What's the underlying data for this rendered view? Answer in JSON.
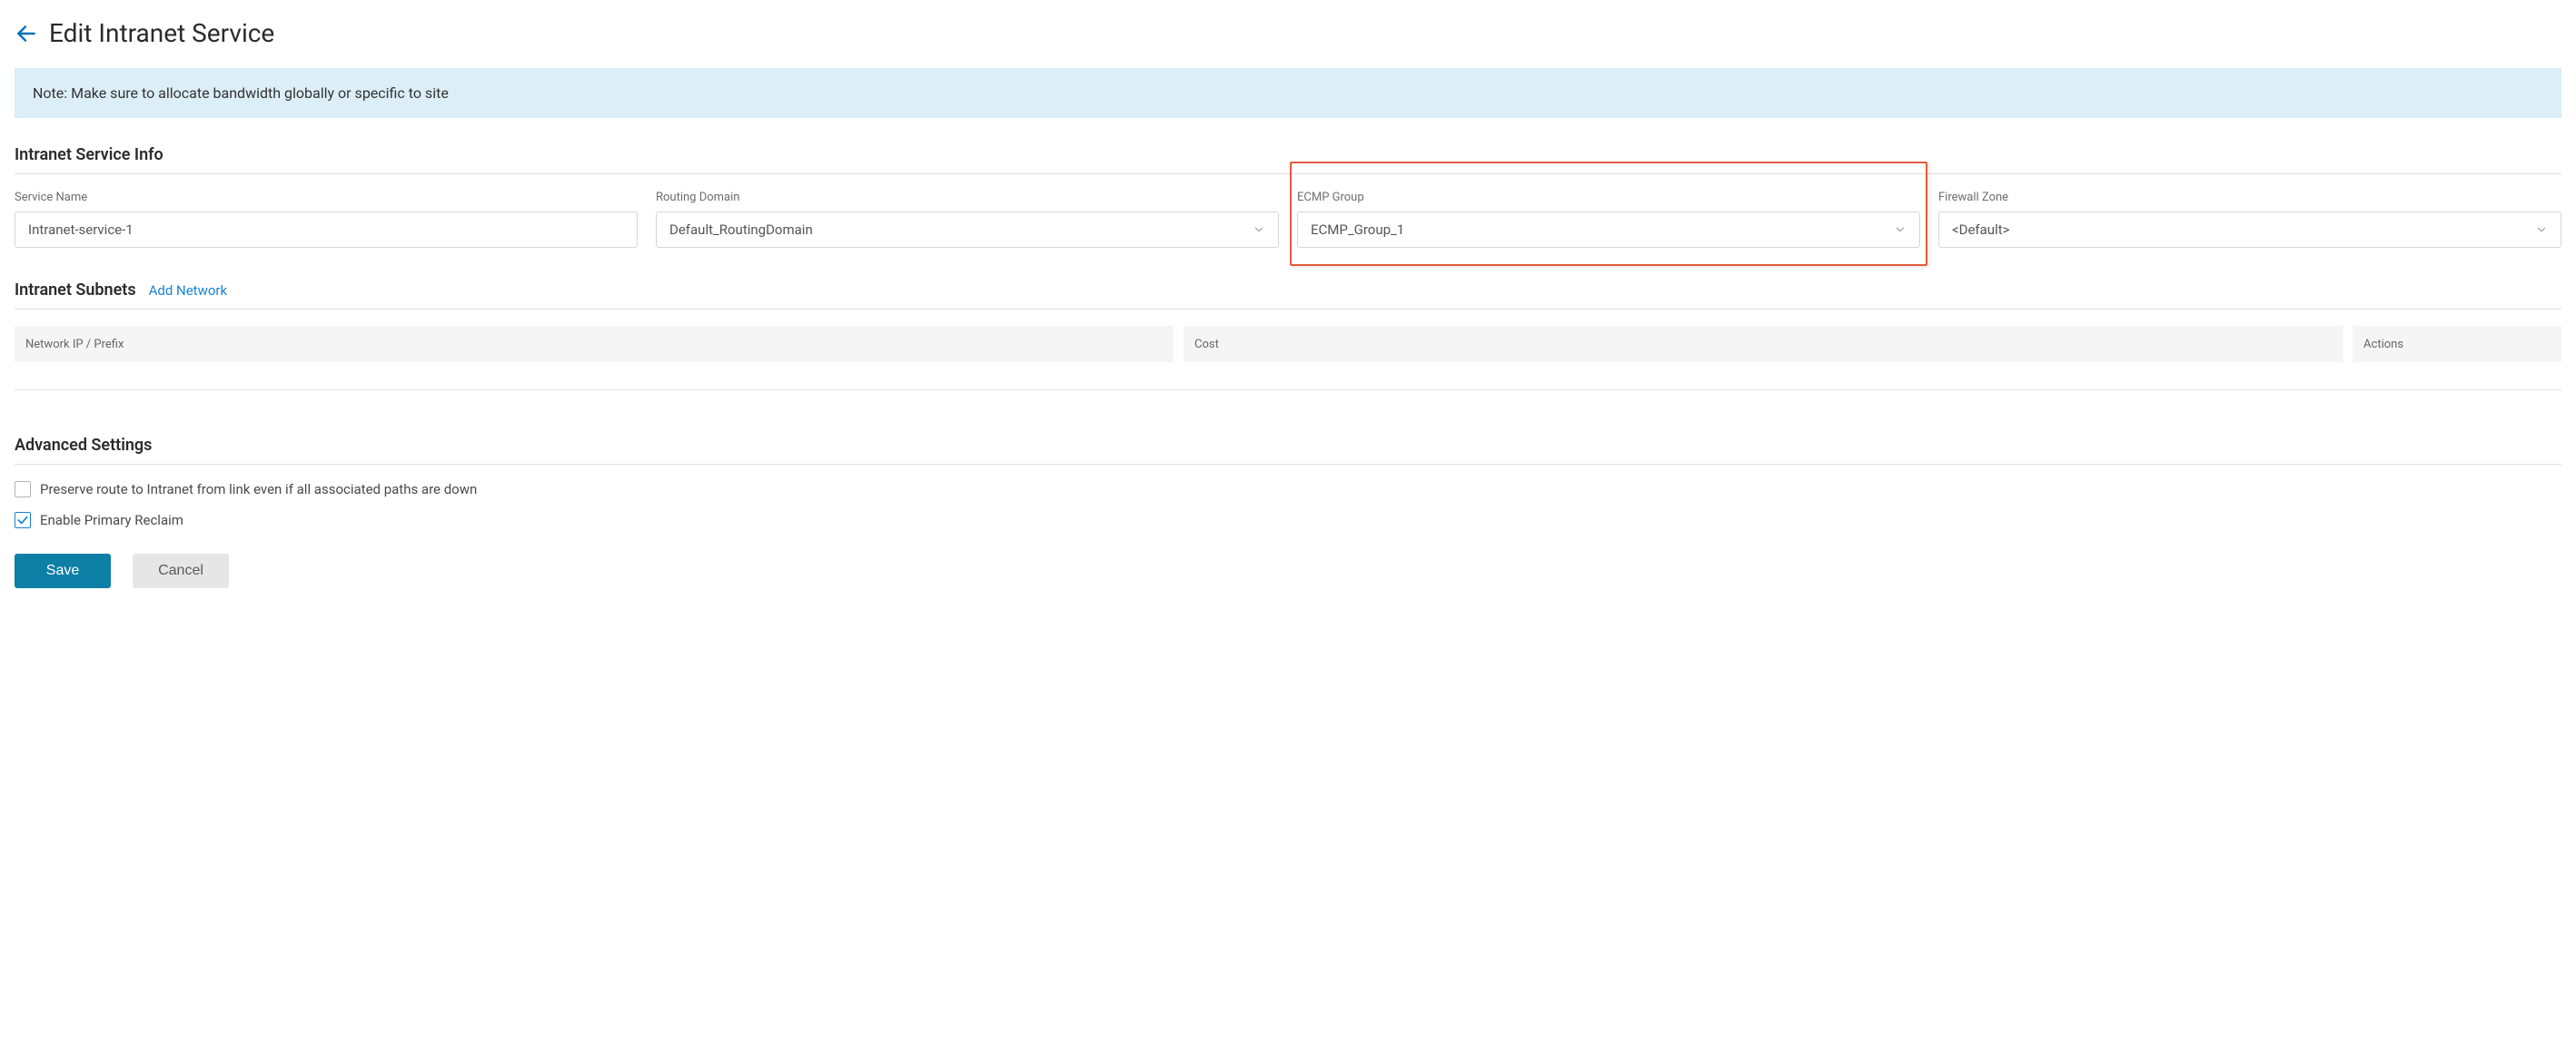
{
  "header": {
    "title": "Edit Intranet Service"
  },
  "note": "Note: Make sure to allocate bandwidth globally or specific to site",
  "sections": {
    "info_heading": "Intranet Service Info",
    "subnets_heading": "Intranet Subnets",
    "advanced_heading": "Advanced Settings"
  },
  "fields": {
    "service_name": {
      "label": "Service Name",
      "value": "Intranet-service-1"
    },
    "routing_domain": {
      "label": "Routing Domain",
      "value": "Default_RoutingDomain"
    },
    "ecmp_group": {
      "label": "ECMP Group",
      "value": "ECMP_Group_1"
    },
    "firewall_zone": {
      "label": "Firewall Zone",
      "value": "<Default>"
    }
  },
  "subnets": {
    "add_link": "Add Network",
    "columns": {
      "network_ip": "Network IP / Prefix",
      "cost": "Cost",
      "actions": "Actions"
    }
  },
  "advanced": {
    "preserve_route": {
      "label": "Preserve route to Intranet from link even if all associated paths are down",
      "checked": false
    },
    "enable_primary_reclaim": {
      "label": "Enable Primary Reclaim",
      "checked": true
    }
  },
  "buttons": {
    "save": "Save",
    "cancel": "Cancel"
  },
  "highlight": {
    "field": "ecmp_group",
    "color": "#e45a3f"
  }
}
